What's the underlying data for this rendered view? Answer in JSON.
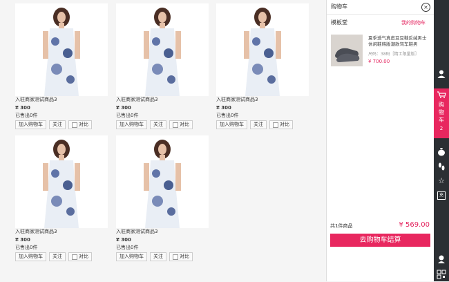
{
  "products": [
    {
      "title": "入驻商家测试商品3",
      "price": "¥ 300",
      "sold": "已售出0件",
      "add_cart": "加入购物车",
      "follow": "关注",
      "compare": "对比"
    },
    {
      "title": "入驻商家测试商品3",
      "price": "¥ 300",
      "sold": "已售出0件",
      "add_cart": "加入购物车",
      "follow": "关注",
      "compare": "对比"
    },
    {
      "title": "入驻商家测试商品3",
      "price": "¥ 300",
      "sold": "已售出0件",
      "add_cart": "加入购物车",
      "follow": "关注",
      "compare": "对比"
    },
    {
      "title": "入驻商家测试商品3",
      "price": "¥ 300",
      "sold": "已售出0件",
      "add_cart": "加入购物车",
      "follow": "关注",
      "compare": "对比"
    },
    {
      "title": "入驻商家测试商品3",
      "price": "¥ 300",
      "sold": "已售出0件",
      "add_cart": "加入购物车",
      "follow": "关注",
      "compare": "对比"
    }
  ],
  "cart_panel": {
    "title": "购物车",
    "shop_name": "模板堂",
    "my_cart_link": "我的购物车",
    "item": {
      "name": "夏季透气真皮豆豆鞋反绒男士休闲鞋韩版潮款驾车鞋男",
      "spec": "尺码：38码［精工限量版］",
      "price": "¥ 700.00"
    },
    "total_label": "共1件商品",
    "total_price": "¥ 569.00",
    "checkout_label": "去购物车结算"
  },
  "right_bar": {
    "cart_label_chars": [
      "购",
      "物",
      "车"
    ],
    "cart_count": "2",
    "recharge_label": "充",
    "accent": "#e8275f"
  }
}
